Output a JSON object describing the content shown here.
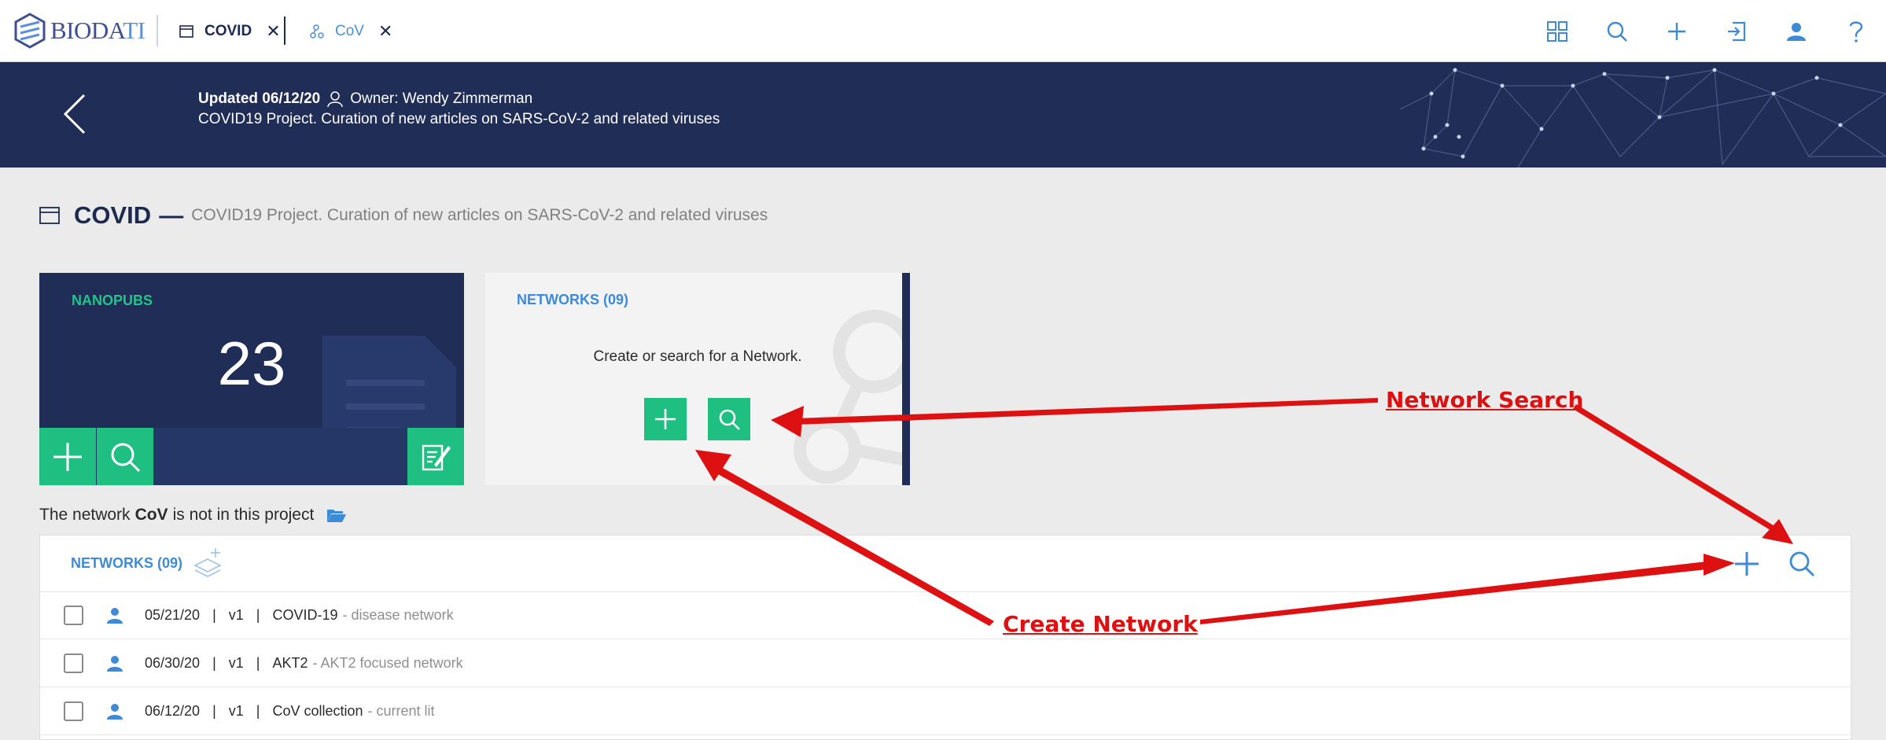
{
  "app": {
    "logo_text_main": "BIODA",
    "logo_text_accent": "TI"
  },
  "tabs": [
    {
      "label": "COVID",
      "icon": "window-icon",
      "active": true
    },
    {
      "label": "CoV",
      "icon": "network-icon",
      "active": false
    }
  ],
  "top_icons": [
    "apps-grid-icon",
    "search-icon",
    "plus-icon",
    "sign-in-icon",
    "user-icon",
    "help-icon"
  ],
  "banner": {
    "updated": "Updated 06/12/20",
    "owner": "Owner: Wendy Zimmerman",
    "description": "COVID19 Project. Curation of new articles on SARS-CoV-2 and related viruses"
  },
  "page": {
    "title": "COVID",
    "dash": "—",
    "description": "COVID19 Project. Curation of new articles on SARS-CoV-2 and related viruses"
  },
  "nanopubs_card": {
    "label": "NANOPUBS",
    "count": "23"
  },
  "networks_card": {
    "label": "NETWORKS (09)",
    "text": "Create or search for a Network."
  },
  "note": {
    "prefix": "The network",
    "network": "CoV",
    "suffix": "is not in this project"
  },
  "networks_panel": {
    "title": "NETWORKS (09)",
    "rows": [
      {
        "date": "05/21/20",
        "version": "v1",
        "name": "COVID-19",
        "desc": "- disease network"
      },
      {
        "date": "06/30/20",
        "version": "v1",
        "name": "AKT2",
        "desc": "- AKT2 focused network"
      },
      {
        "date": "06/12/20",
        "version": "v1",
        "name": "CoV collection",
        "desc": "- current lit"
      }
    ],
    "separator": "|"
  },
  "annotations": {
    "network_search": "Network Search",
    "create_network": "Create Network",
    "color": "#dd1111"
  },
  "colors": {
    "navy": "#1f2d57",
    "green": "#1fbf82",
    "blue": "#3d8ad6"
  }
}
